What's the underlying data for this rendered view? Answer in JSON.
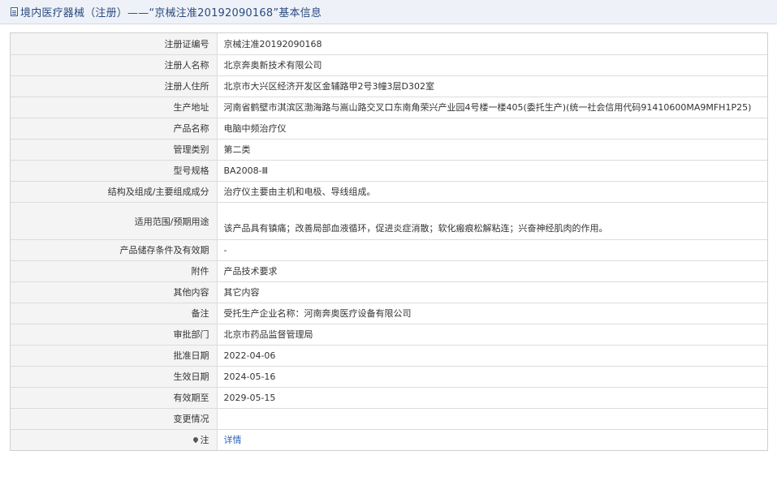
{
  "header": {
    "title": "境内医疗器械（注册）——“京械注准20192090168”基本信息"
  },
  "rows": [
    {
      "label": "注册证编号",
      "value": "京械注准20192090168"
    },
    {
      "label": "注册人名称",
      "value": "北京奔奥新技术有限公司"
    },
    {
      "label": "注册人住所",
      "value": "北京市大兴区经济开发区金辅路甲2号3幢3层D302室"
    },
    {
      "label": "生产地址",
      "value": "河南省鹤壁市淇滨区渤海路与嵩山路交叉口东南角荣兴产业园4号楼一楼405(委托生产)(统一社会信用代码91410600MA9MFH1P25)"
    },
    {
      "label": "产品名称",
      "value": "电脑中频治疗仪"
    },
    {
      "label": "管理类别",
      "value": "第二类"
    },
    {
      "label": "型号规格",
      "value": "BA2008-Ⅲ"
    },
    {
      "label": "结构及组成/主要组成成分",
      "value": "治疗仪主要由主机和电极、导线组成。"
    },
    {
      "label": "适用范围/预期用途",
      "value": "该产品具有镇痛；改善局部血液循环，促进炎症消散；软化瘢痕松解粘连；兴奋神经肌肉的作用。"
    },
    {
      "label": "产品储存条件及有效期",
      "value": "-"
    },
    {
      "label": "附件",
      "value": "产品技术要求"
    },
    {
      "label": "其他内容",
      "value": "其它内容"
    },
    {
      "label": "备注",
      "value": "受托生产企业名称：河南奔奥医疗设备有限公司"
    },
    {
      "label": "审批部门",
      "value": "北京市药品监督管理局"
    },
    {
      "label": "批准日期",
      "value": "2022-04-06"
    },
    {
      "label": "生效日期",
      "value": "2024-05-16"
    },
    {
      "label": "有效期至",
      "value": "2029-05-15"
    },
    {
      "label": "变更情况",
      "value": ""
    }
  ],
  "note": {
    "label": "注",
    "link_text": "详情"
  }
}
